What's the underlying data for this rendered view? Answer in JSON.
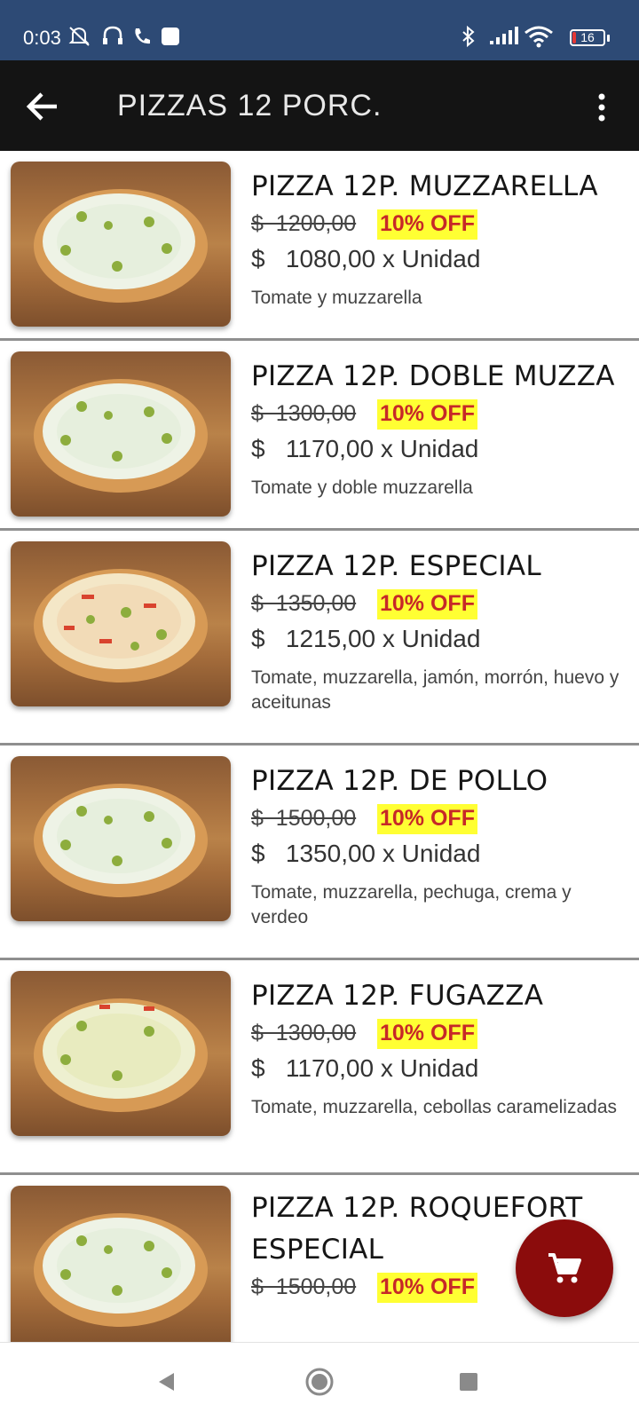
{
  "status_bar": {
    "time": "0:03",
    "battery_level": "16",
    "icons": [
      "mute-icon",
      "headset-icon",
      "phone-icon",
      "app-icon",
      "bluetooth-icon",
      "signal-icon",
      "wifi-icon",
      "battery-icon"
    ]
  },
  "app_bar": {
    "title": "PIZZAS 12 PORC.",
    "back_icon": "arrow-left-icon",
    "menu_icon": "more-vertical-icon"
  },
  "products": [
    {
      "name": "PIZZA 12P. MUZZARELLA",
      "old_price": "$  1200,00",
      "discount": "10% OFF",
      "price": "$   1080,00 x Unidad",
      "description": "Tomate y muzzarella"
    },
    {
      "name": "PIZZA 12P. DOBLE MUZZA",
      "old_price": "$  1300,00",
      "discount": "10% OFF",
      "price": "$   1170,00 x Unidad",
      "description": "Tomate y doble muzzarella"
    },
    {
      "name": "PIZZA 12P. ESPECIAL",
      "old_price": "$  1350,00",
      "discount": "10% OFF",
      "price": "$   1215,00 x Unidad",
      "description": "Tomate, muzzarella, jamón, morrón, huevo y aceitunas"
    },
    {
      "name": "PIZZA 12P. DE POLLO",
      "old_price": "$  1500,00",
      "discount": "10% OFF",
      "price": "$   1350,00 x Unidad",
      "description": "Tomate, muzzarella, pechuga, crema y verdeo"
    },
    {
      "name": "PIZZA 12P. FUGAZZA",
      "old_price": "$  1300,00",
      "discount": "10% OFF",
      "price": "$   1170,00 x Unidad",
      "description": "Tomate, muzzarella, cebollas caramelizadas"
    },
    {
      "name": "PIZZA 12P. ROQUEFORT ESPECIAL",
      "old_price": "$  1500,00",
      "discount": "10% OFF",
      "price": "",
      "description": ""
    }
  ],
  "fab": {
    "icon": "cart-icon"
  },
  "nav_bar": {
    "icons": [
      "back-triangle-icon",
      "home-circle-icon",
      "recents-square-icon"
    ]
  },
  "colors": {
    "status_bar": "#2d4a75",
    "app_bar": "#141414",
    "discount_bg": "#ffff33",
    "discount_text": "#c62828",
    "fab": "#8b0c0c"
  }
}
